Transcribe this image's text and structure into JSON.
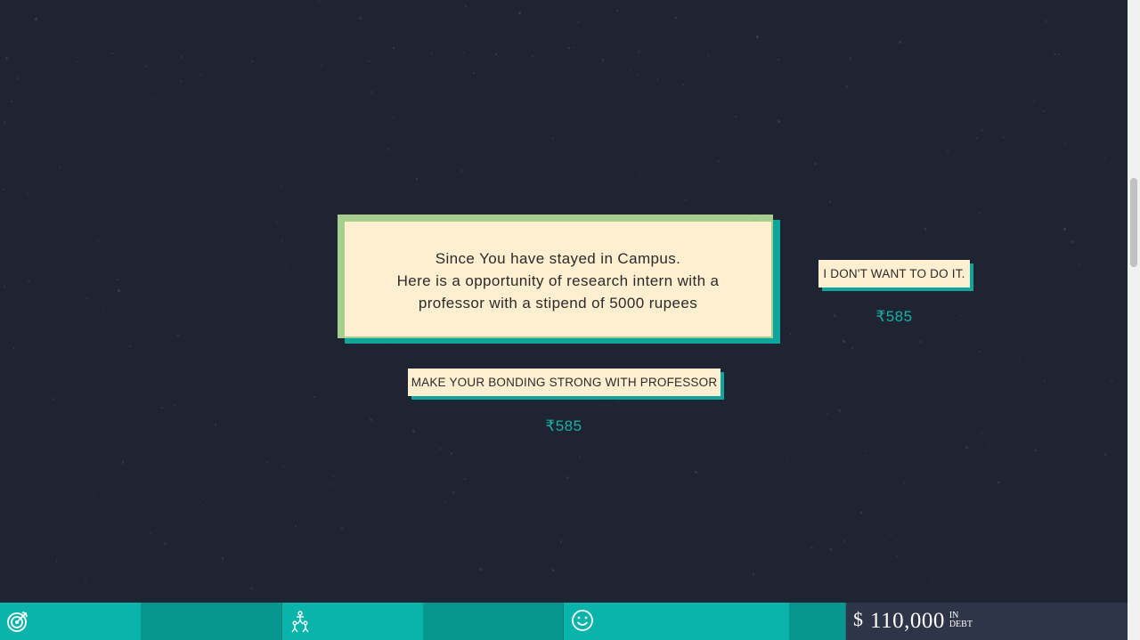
{
  "prompt": {
    "lines": [
      "Since You have stayed in Campus.",
      "Here is a opportunity of research intern with a",
      "professor with a stipend of 5000 rupees"
    ]
  },
  "choices": [
    {
      "label": "I DON'T WANT TO DO IT.",
      "price": "₹585"
    },
    {
      "label": "MAKE YOUR BONDING STRONG WITH PROFESSOR",
      "price": "₹585"
    }
  ],
  "stats": [
    {
      "icon": "target-icon",
      "level": 0.5
    },
    {
      "icon": "people-icon",
      "level": 0.5
    },
    {
      "icon": "smiley-icon",
      "level": 0.8
    }
  ],
  "debt": {
    "currency": "$",
    "amount": "110,000",
    "label_top": "IN",
    "label_bottom": "DEBT"
  },
  "colors": {
    "background": "#1f2433",
    "card": "#fdefd0",
    "card_border": "#a6cf8f",
    "accent": "#0ea59a",
    "price": "#17b1a5",
    "bar_fill": "#0ab4aa",
    "bar_track": "#08978f",
    "debt_bg": "#2e3548"
  }
}
